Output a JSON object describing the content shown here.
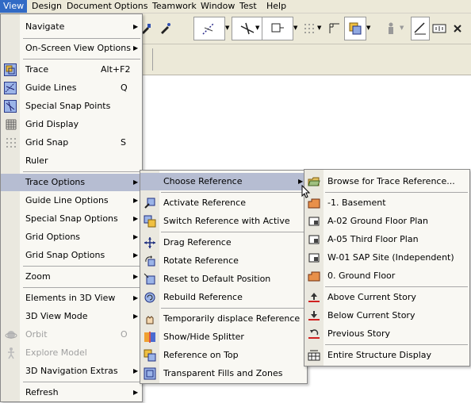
{
  "menubar": {
    "items": [
      "View",
      "Design",
      "Document",
      "Options",
      "Teamwork",
      "Window",
      "Test",
      "Help"
    ]
  },
  "view_menu": {
    "items": [
      {
        "label": "Navigate",
        "submenu": true
      },
      {
        "label": "On-Screen View Options",
        "submenu": true
      },
      {
        "label": "Trace",
        "shortcut": "Alt+F2",
        "icon": "trace-icon",
        "checked": true
      },
      {
        "label": "Guide Lines",
        "shortcut": "Q",
        "icon": "guide-lines-icon",
        "checked": true
      },
      {
        "label": "Special Snap Points",
        "icon": "special-snap-icon",
        "checked": true
      },
      {
        "label": "Grid Display",
        "icon": "grid-display-icon"
      },
      {
        "label": "Grid Snap",
        "shortcut": "S",
        "icon": "grid-snap-icon"
      },
      {
        "label": "Ruler"
      },
      {
        "label": "Trace Options",
        "submenu": true,
        "highlighted": true
      },
      {
        "label": "Guide Line Options",
        "submenu": true
      },
      {
        "label": "Special Snap Options",
        "submenu": true
      },
      {
        "label": "Grid Options",
        "submenu": true
      },
      {
        "label": "Grid Snap Options",
        "submenu": true
      },
      {
        "label": "Zoom",
        "submenu": true
      },
      {
        "label": "Elements in 3D View",
        "submenu": true
      },
      {
        "label": "3D View Mode",
        "submenu": true
      },
      {
        "label": "Orbit",
        "shortcut": "O",
        "disabled": true,
        "icon": "orbit-icon"
      },
      {
        "label": "Explore Model",
        "disabled": true,
        "icon": "explore-model-icon"
      },
      {
        "label": "3D Navigation Extras",
        "submenu": true
      },
      {
        "label": "Refresh",
        "submenu": true
      }
    ]
  },
  "trace_menu": {
    "items": [
      {
        "label": "Choose Reference",
        "submenu": true,
        "highlighted": true
      },
      {
        "label": "Activate Reference",
        "icon": "activate-reference-icon"
      },
      {
        "label": "Switch Reference with Active",
        "icon": "switch-reference-icon"
      },
      {
        "label": "Drag Reference",
        "icon": "drag-reference-icon"
      },
      {
        "label": "Rotate Reference",
        "icon": "rotate-reference-icon"
      },
      {
        "label": "Reset to Default Position",
        "icon": "reset-position-icon"
      },
      {
        "label": "Rebuild Reference",
        "icon": "rebuild-reference-icon"
      },
      {
        "label": "Temporarily displace Reference",
        "icon": "displace-reference-icon"
      },
      {
        "label": "Show/Hide Splitter",
        "icon": "splitter-icon"
      },
      {
        "label": "Reference on Top",
        "icon": "reference-on-top-icon"
      },
      {
        "label": "Transparent Fills and Zones",
        "icon": "transparent-fills-icon"
      }
    ]
  },
  "reference_menu": {
    "items": [
      {
        "label": "Browse for Trace Reference...",
        "icon": "browse-folder-icon"
      },
      {
        "label": "-1. Basement",
        "icon": "story-icon"
      },
      {
        "label": "A-02 Ground Floor Plan",
        "icon": "layout-icon"
      },
      {
        "label": "A-05 Third Floor Plan",
        "icon": "layout-icon"
      },
      {
        "label": "W-01 SAP Site (Independent)",
        "icon": "layout-icon"
      },
      {
        "label": "0. Ground Floor",
        "icon": "story-icon"
      },
      {
        "label": "Above Current Story",
        "icon": "above-story-icon"
      },
      {
        "label": "Below Current Story",
        "icon": "below-story-icon"
      },
      {
        "label": "Previous Story",
        "icon": "previous-story-icon"
      },
      {
        "label": "Entire Structure Display",
        "icon": "structure-display-icon"
      }
    ]
  },
  "colors": {
    "menubar_bg": "#ece9d8",
    "selection": "#316ac5",
    "menu_highlight": "#b6bdd2",
    "menu_bg": "#f9f8f3"
  }
}
